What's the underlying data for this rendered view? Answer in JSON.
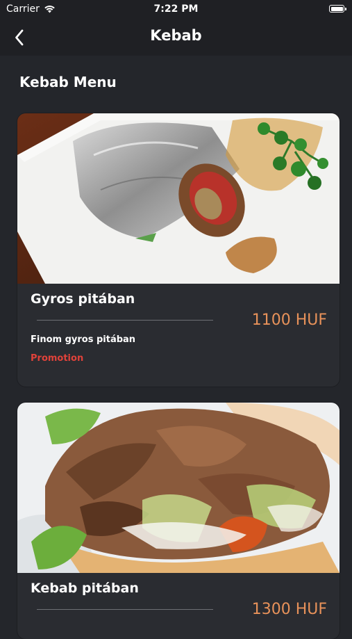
{
  "status_bar": {
    "carrier": "Carrier",
    "time": "7:22 PM"
  },
  "nav": {
    "title": "Kebab"
  },
  "section": {
    "title": "Kebab Menu"
  },
  "items": [
    {
      "name": "Gyros pitában",
      "price": "1100 HUF",
      "description": "Finom gyros pitában",
      "tag": "Promotion",
      "image_icon": "gyros-wrap-photo"
    },
    {
      "name": "Kebab pitában",
      "price": "1300 HUF",
      "description": "",
      "tag": "",
      "image_icon": "kebab-pita-photo"
    }
  ],
  "colors": {
    "background": "#24262b",
    "card": "#2a2c31",
    "price": "#e8925a",
    "promotion": "#e0423a"
  }
}
